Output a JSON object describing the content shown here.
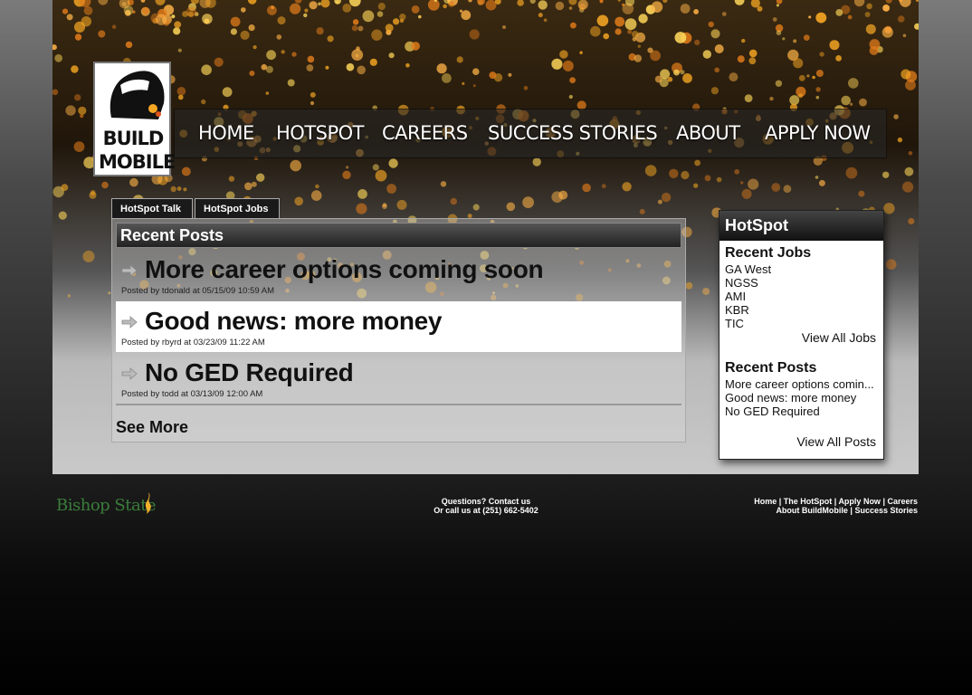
{
  "brand": {
    "logo_line1": "BUILD",
    "logo_line2": "MOBILE"
  },
  "nav": {
    "items": [
      "HOME",
      "HOTSPOT",
      "CAREERS",
      "SUCCESS STORIES",
      "ABOUT",
      "APPLY NOW"
    ]
  },
  "tabs": [
    "HotSpot Talk",
    "HotSpot Jobs"
  ],
  "recent_posts": {
    "heading": "Recent Posts",
    "posts": [
      {
        "title": "More career options coming soon",
        "meta": "Posted by tdonald at 05/15/09 10:59 AM"
      },
      {
        "title": "Good news: more money",
        "meta": "Posted by rbyrd at 03/23/09 11:22 AM"
      },
      {
        "title": "No GED Required",
        "meta": "Posted by todd at 03/13/09 12:00 AM"
      }
    ],
    "see_more": "See More"
  },
  "hotspot": {
    "title": "HotSpot",
    "recent_jobs_heading": "Recent Jobs",
    "jobs": [
      "GA West",
      "NGSS",
      "AMI",
      "KBR",
      "TIC"
    ],
    "view_all_jobs": "View All Jobs",
    "recent_posts_heading": "Recent Posts",
    "posts": [
      "More career options comin...",
      "Good news: more money",
      "No GED Required"
    ],
    "view_all_posts": "View All Posts"
  },
  "footer": {
    "partner": "Bishop State",
    "contact_line1": "Questions? Contact us",
    "contact_line2": "Or call us at (251) 662-5402",
    "links_line1": [
      "Home",
      "The HotSpot",
      "Apply Now",
      "Careers"
    ],
    "links_line2": [
      "About BuildMobile",
      "Success Stories"
    ],
    "separator": " | "
  },
  "colors": {
    "footer_partner_green": "#3a7d3a",
    "spark_orange": "#f5a623",
    "spark_yellow": "#ffd75a"
  }
}
